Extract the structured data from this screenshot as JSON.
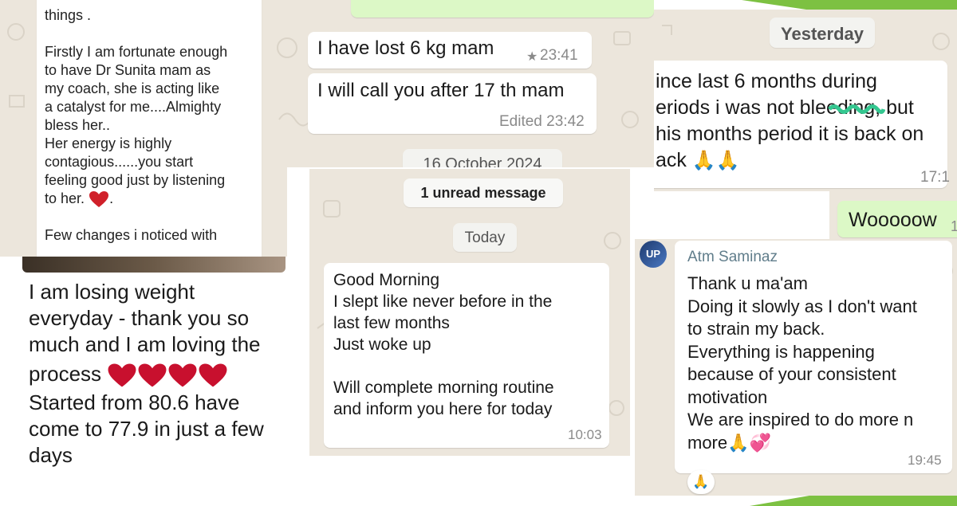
{
  "colors": {
    "chat_bg": "#ece6dc",
    "bubble_in": "#ffffff",
    "bubble_out": "#dcf8c6",
    "accent_green": "#7dc142",
    "heart_red": "#d0202a",
    "sender_name": "#607d8b"
  },
  "panel_a": {
    "lines": [
      "things .",
      "",
      "Firstly I am fortunate enough",
      "to have Dr Sunita mam as",
      "my coach, she is acting like",
      "a catalyst for me....Almighty",
      "bless her..",
      "Her energy is highly",
      "contagious......you start",
      "feeling good just by listening",
      "to her.",
      "",
      "Few changes i noticed with"
    ],
    "heart_icon": "red-heart-icon"
  },
  "panel_b": {
    "msg1": "I have lost 6 kg mam",
    "msg1_time": "23:41",
    "star_icon": "star-icon",
    "msg2": "I will call you after 17 th mam",
    "msg2_time": "Edited 23:42",
    "date_divider": "16 October 2024"
  },
  "panel_c": {
    "day_label": "Yesterday",
    "lines": [
      "ince last 6 months during",
      "eriods i was not bleeding,  but",
      "his months period it is back on",
      "ack"
    ],
    "time": "17:1",
    "reply": "Wooooow",
    "reply_time": "1",
    "hands_icon": "folded-hands-icon"
  },
  "panel_d": {
    "unread": "1 unread message",
    "day_label": "Today",
    "lines": [
      "Good Morning",
      "I slept like never before in the",
      "last few months",
      "Just woke up",
      "",
      "Will complete morning routine",
      "and inform you here for today"
    ],
    "time": "10:03"
  },
  "panel_e": {
    "lines": [
      "I am losing weight",
      "everyday - thank you so",
      "much and I am loving the",
      "process",
      "Started from 80.6 have",
      "come to 77.9 in just a few",
      "days"
    ],
    "heart_icon": "red-heart-icon"
  },
  "panel_f": {
    "avatar_text": "UP",
    "sender": "Atm Saminaz",
    "lines": [
      "Thank u ma'am",
      "Doing it slowly as I don't want",
      "to strain my back.",
      "Everything is happening",
      "because of your consistent",
      "motivation",
      "We are inspired to do more n",
      "more"
    ],
    "time": "19:45",
    "hands_icon": "folded-hands-icon",
    "hearts_icon": "two-hearts-icon",
    "reaction_icon": "folded-hands-reaction-icon"
  }
}
